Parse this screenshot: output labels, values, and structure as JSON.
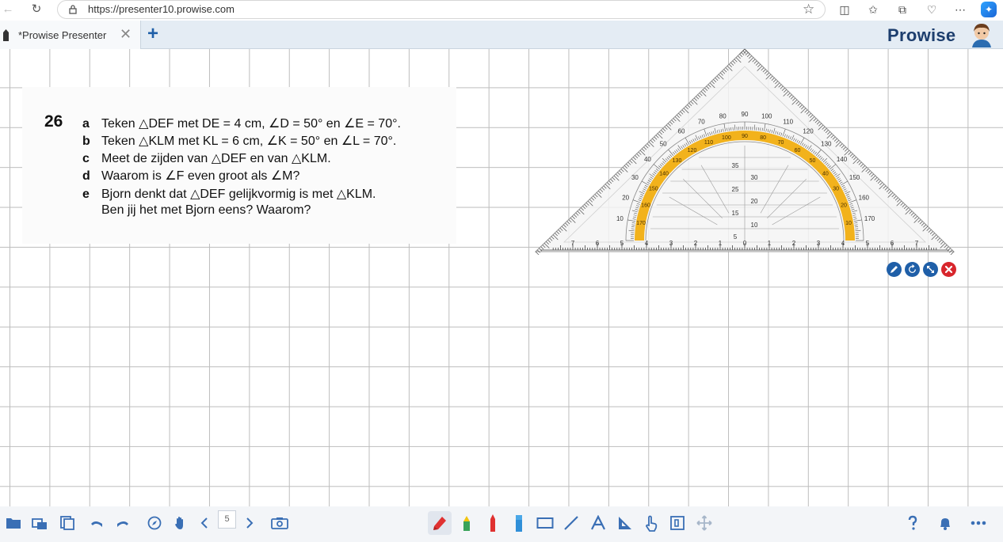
{
  "browser": {
    "url": "https://presenter10.prowise.com"
  },
  "app": {
    "tab_title": "*Prowise Presenter",
    "brand": "Prowise"
  },
  "exercise": {
    "number": "26",
    "items": [
      {
        "letter": "a",
        "text": "Teken △DEF met DE = 4 cm, ∠D = 50° en ∠E = 70°."
      },
      {
        "letter": "b",
        "text": "Teken △KLM met KL = 6 cm, ∠K = 50° en ∠L = 70°."
      },
      {
        "letter": "c",
        "text": "Meet de zijden van △DEF en van △KLM."
      },
      {
        "letter": "d",
        "text": "Waarom is ∠F even groot als ∠M?"
      },
      {
        "letter": "e",
        "text": "Bjorn denkt dat △DEF gelijkvormig is met △KLM."
      },
      {
        "letter": "",
        "text": "Ben jij het met Bjorn eens? Waarom?"
      }
    ]
  },
  "toolbar": {
    "page_number": "5"
  },
  "colors": {
    "accent": "#1f5fa8",
    "brand": "#1d3e6e",
    "protractor_arc": "#f2b21c",
    "close_red": "#d8262c"
  }
}
